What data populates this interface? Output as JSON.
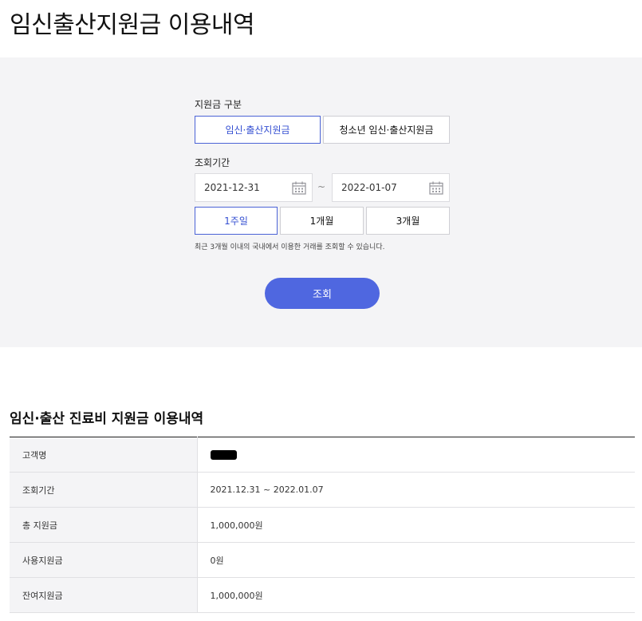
{
  "page": {
    "title": "임신출산지원금 이용내역"
  },
  "search": {
    "type_label": "지원금 구분",
    "types": [
      {
        "label": "임신·출산지원금",
        "selected": true
      },
      {
        "label": "청소년 임신·출산지원금",
        "selected": false
      }
    ],
    "period_label": "조회기간",
    "date_from": "2021-12-31",
    "date_to": "2022-01-07",
    "tilde": "~",
    "periods": [
      {
        "label": "1주일",
        "selected": true
      },
      {
        "label": "1개월",
        "selected": false
      },
      {
        "label": "3개월",
        "selected": false
      }
    ],
    "notice": "최근 3개월 이내의 국내에서 이용한 거래를 조회할 수 있습니다.",
    "submit_label": "조회",
    "colors": {
      "accent": "#4f67e0",
      "panel_bg": "#f4f4f6"
    }
  },
  "result": {
    "title": "임신·출산 진료비 지원금 이용내역",
    "rows": [
      {
        "label": "고객명",
        "value": ""
      },
      {
        "label": "조회기간",
        "value": "2021.12.31 ~ 2022.01.07"
      },
      {
        "label": "총 지원금",
        "value": "1,000,000원"
      },
      {
        "label": "사용지원금",
        "value": "0원"
      },
      {
        "label": "잔여지원금",
        "value": "1,000,000원"
      }
    ]
  }
}
